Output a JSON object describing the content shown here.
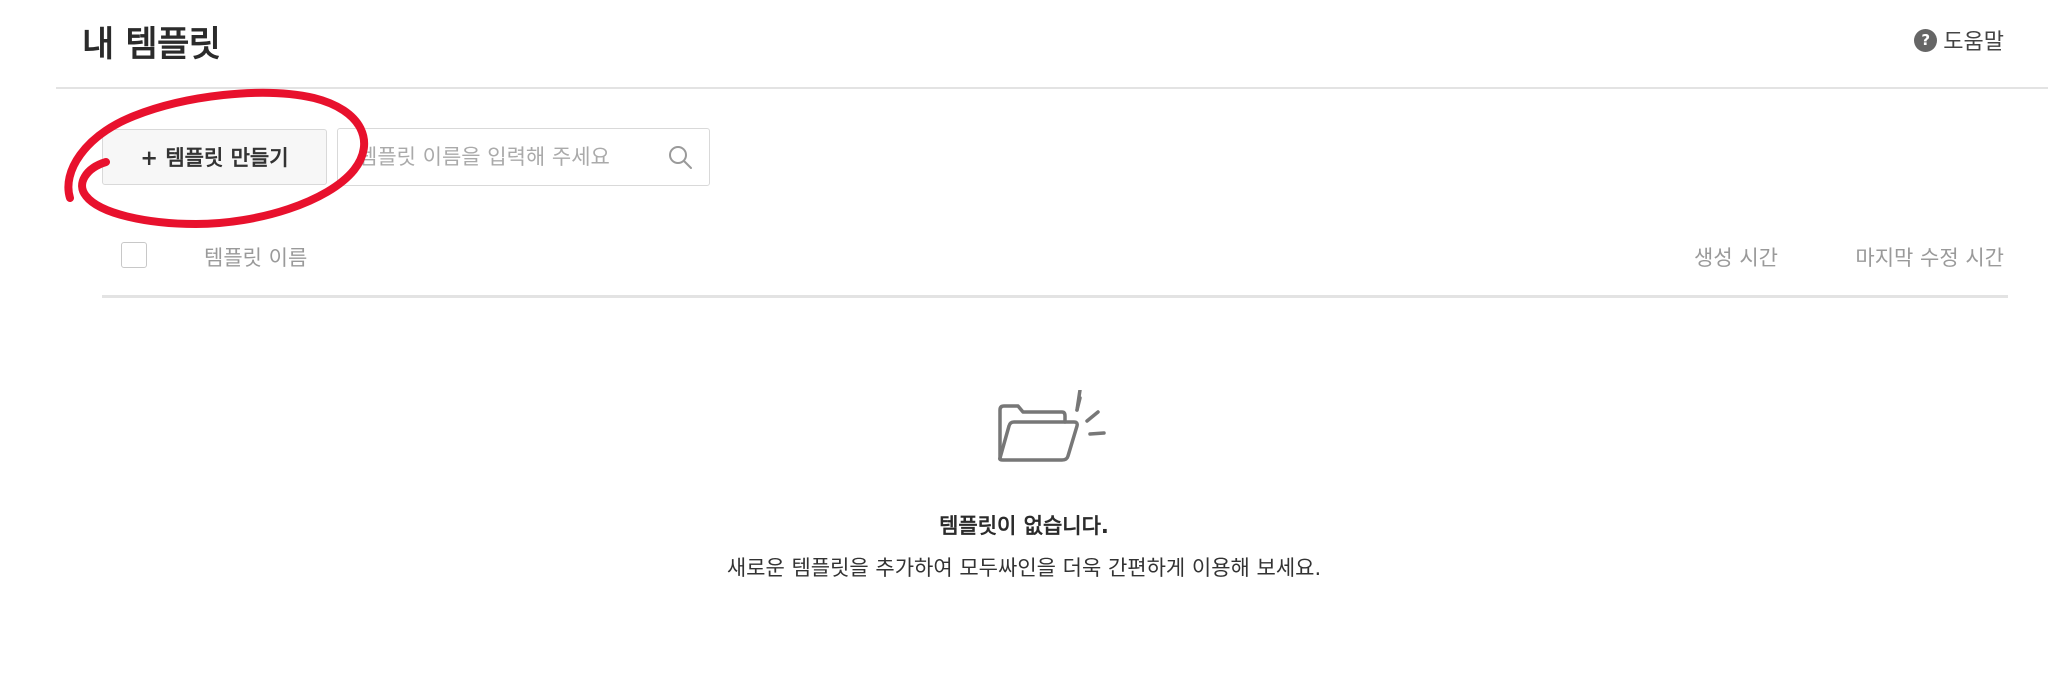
{
  "header": {
    "title": "내 템플릿",
    "help_label": "도움말",
    "help_icon_glyph": "?"
  },
  "toolbar": {
    "create_label": "+ 템플릿 만들기",
    "search_placeholder": "템플릿 이름을 입력해 주세요",
    "search_value": ""
  },
  "table": {
    "columns": {
      "name": "템플릿 이름",
      "created": "생성 시간",
      "modified": "마지막 수정 시간"
    }
  },
  "empty_state": {
    "title": "템플릿이 없습니다.",
    "description": "새로운 템플릿을 추가하여 모두싸인을 더욱 간편하게 이용해 보세요."
  },
  "colors": {
    "annotation": "#e8112d",
    "divider": "#e3e3e3",
    "muted_text": "#9a9a9a"
  }
}
